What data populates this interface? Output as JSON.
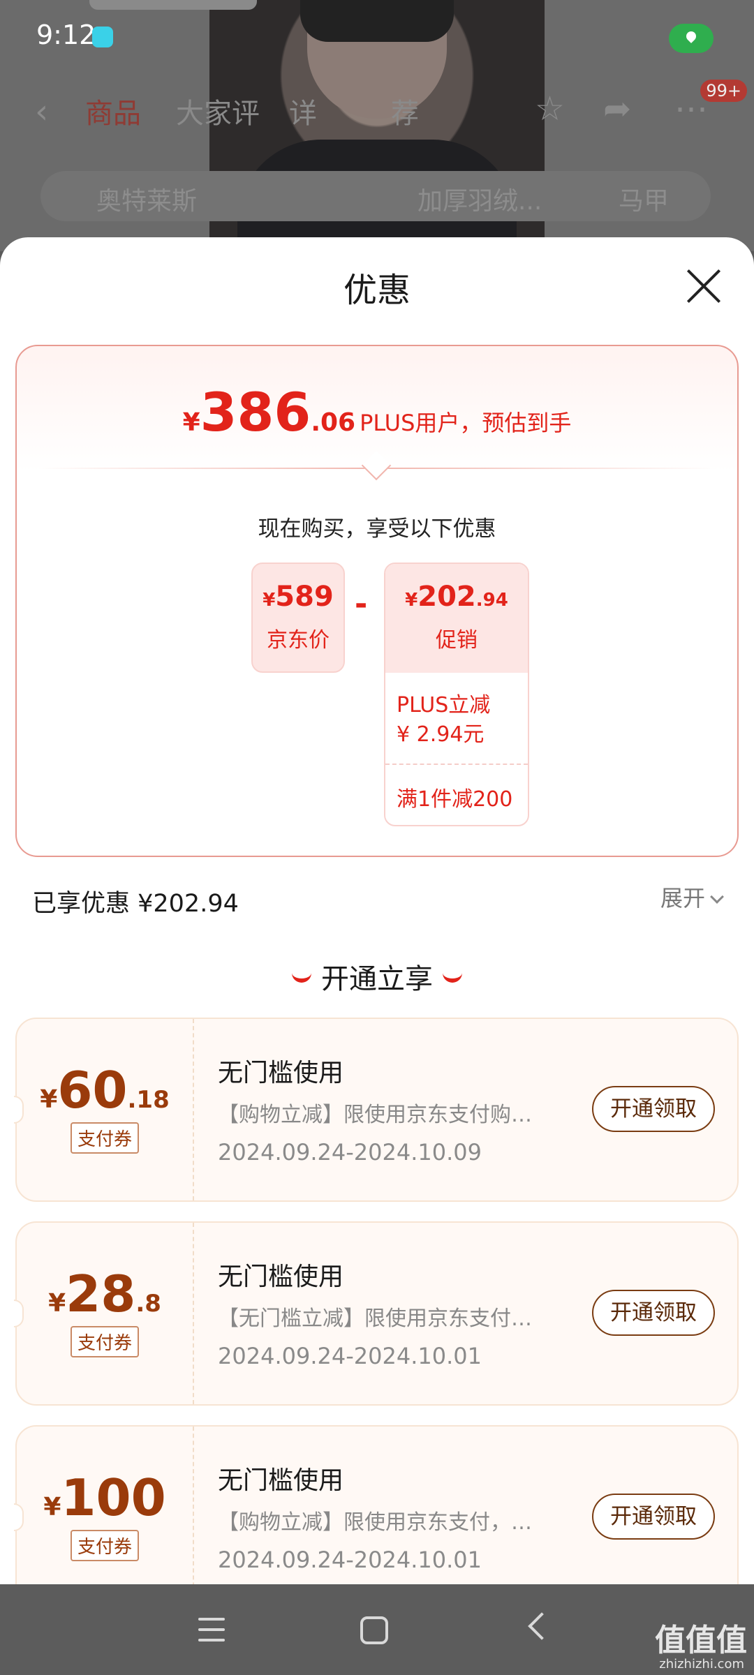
{
  "status": {
    "time": "9:12"
  },
  "background": {
    "tabs": [
      "商品",
      "大家评",
      "详",
      "荐"
    ],
    "cart_badge": "99+",
    "search_placeholder": "奥特莱斯",
    "search_chip_1": "加厚羽绒...",
    "search_chip_2": "马甲"
  },
  "sheet": {
    "title": "优惠",
    "summary": {
      "currency": "¥",
      "price_int": "386",
      "price_dec": ".06",
      "price_desc": "PLUS用户，预估到手",
      "now_buy": "现在购买，享受以下优惠",
      "jd_price": {
        "currency": "¥",
        "value": "589",
        "label": "京东价"
      },
      "minus": "-",
      "promo": {
        "currency": "¥",
        "value_int": "202",
        "value_dec": ".94",
        "label": "促销",
        "items": [
          "PLUS立减\n¥ 2.94元",
          "满1件减200"
        ],
        "item1_line1": "PLUS立减",
        "item1_line2": "¥ 2.94元",
        "item2": "满1件减200"
      }
    },
    "enjoyed": "已享优惠 ¥202.94",
    "expand_label": "展开",
    "section_title": "开通立享",
    "coupons": [
      {
        "currency": "¥",
        "int": "60",
        "dec": ".18",
        "tag": "支付券",
        "title": "无门槛使用",
        "desc": "【购物立减】限使用京东支付购…",
        "date": "2024.09.24-2024.10.09",
        "button": "开通领取"
      },
      {
        "currency": "¥",
        "int": "28",
        "dec": ".8",
        "tag": "支付券",
        "title": "无门槛使用",
        "desc": "【无门槛立减】限使用京东支付…",
        "date": "2024.09.24-2024.10.01",
        "button": "开通领取"
      },
      {
        "currency": "¥",
        "int": "100",
        "dec": "",
        "tag": "支付券",
        "title": "无门槛使用",
        "desc": "【购物立减】限使用京东支付，…",
        "date": "2024.09.24-2024.10.01",
        "button": "开通领取"
      }
    ]
  },
  "watermark": {
    "main": "值值值",
    "sub": "zhizhizhi.com"
  },
  "colors": {
    "accent_red": "#e2231a",
    "coupon_brown": "#9a3b0b",
    "nav_bg": "#5c5c5c"
  }
}
